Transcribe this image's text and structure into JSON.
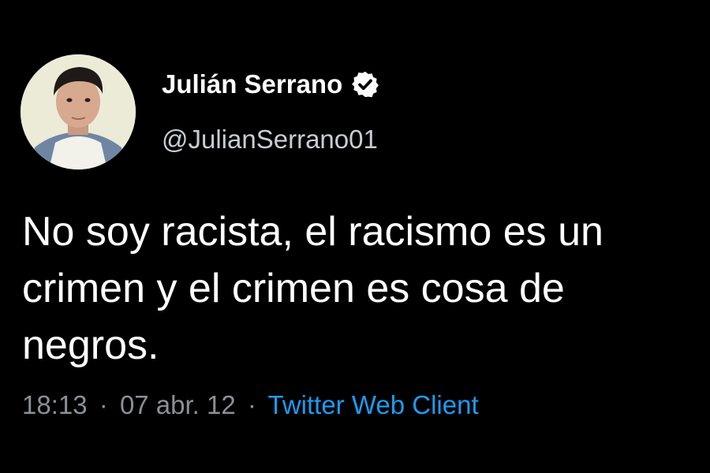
{
  "author": {
    "display_name": "Julián Serrano",
    "handle": "@JulianSerrano01",
    "verified_icon": "verified-badge-icon"
  },
  "tweet": {
    "text": "No soy racista, el racismo es un crimen y el crimen es cosa de negros.",
    "time": "18:13",
    "separator": "·",
    "date": "07 abr. 12",
    "client": "Twitter Web Client"
  },
  "colors": {
    "background": "#000000",
    "text": "#ffffff",
    "muted": "#8b9096",
    "link": "#1d9bf0"
  }
}
